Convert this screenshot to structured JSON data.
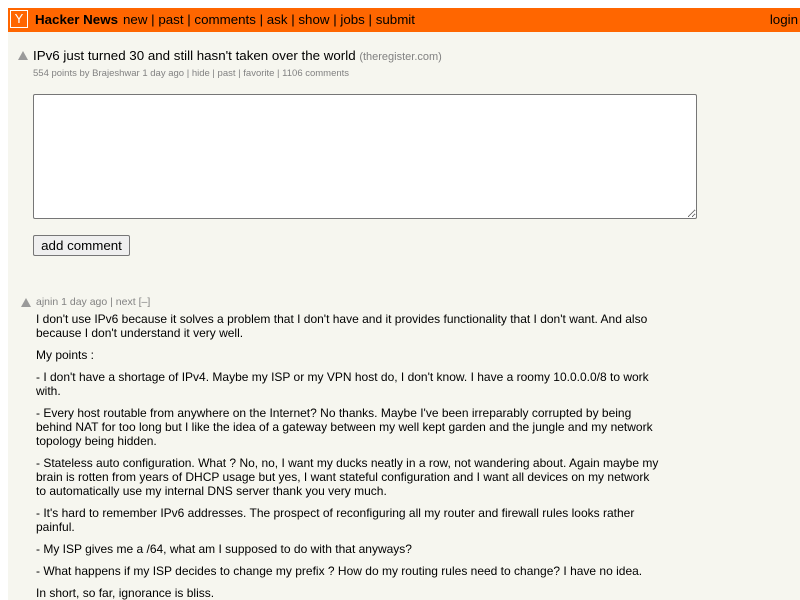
{
  "header": {
    "logo_letter": "Y",
    "site_name": "Hacker News",
    "nav": [
      "new",
      "past",
      "comments",
      "ask",
      "show",
      "jobs",
      "submit"
    ],
    "login": "login",
    "bar_color": "#ff6600"
  },
  "story": {
    "title": "IPv6 just turned 30 and still hasn't taken over the world",
    "site": "(theregister.com)",
    "points": "554 points",
    "by_label": "by",
    "user": "Brajeshwar",
    "age": "1 day ago",
    "hide": "hide",
    "past": "past",
    "favorite": "favorite",
    "comments": "1106 comments"
  },
  "form": {
    "textarea_value": "",
    "button_label": "add comment"
  },
  "comment": {
    "user": "ajnin",
    "age": "1 day ago",
    "next": "next",
    "toggle": "[–]",
    "paragraphs": [
      "I don't use IPv6 because it solves a problem that I don't have and it provides functionality that I don't want. And also because I don't understand it very well.",
      "My points :",
      "- I don't have a shortage of IPv4. Maybe my ISP or my VPN host do, I don't know. I have a roomy 10.0.0.0/8 to work with.",
      "- Every host routable from anywhere on the Internet? No thanks. Maybe I've been irreparably corrupted by being behind NAT for too long but I like the idea of a gateway between my well kept garden and the jungle and my network topology being hidden.",
      "- Stateless auto configuration. What ? No, no, I want my ducks neatly in a row, not wandering about. Again maybe my brain is rotten from years of DHCP usage but yes, I want stateful configuration and I want all devices on my network to automatically use my internal DNS server thank you very much.",
      "- It's hard to remember IPv6 addresses. The prospect of reconfiguring all my router and firewall rules looks rather painful.",
      "- My ISP gives me a /64, what am I supposed to do with that anyways?",
      "- What happens if my ISP decides to change my prefix ? How do my routing rules need to change? I have no idea.",
      "In short, so far, ignorance is bliss."
    ]
  }
}
